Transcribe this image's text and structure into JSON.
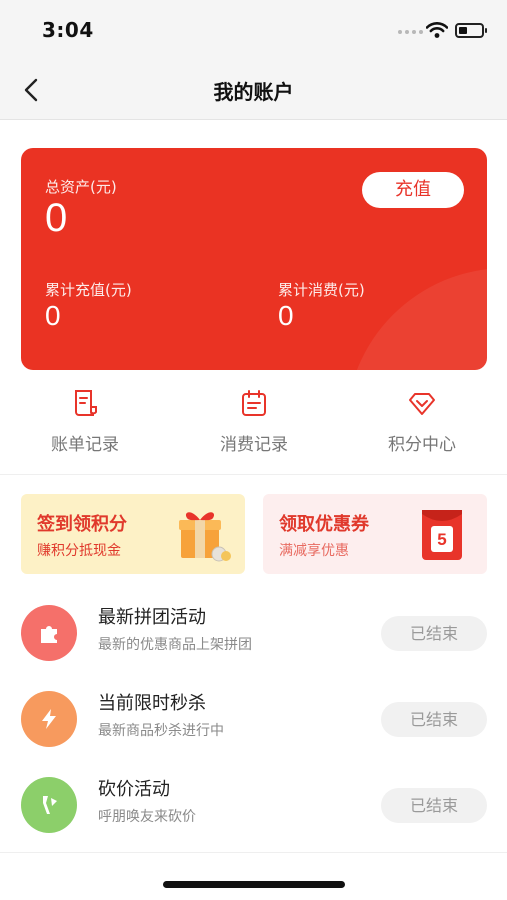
{
  "status_bar": {
    "time": "3:04"
  },
  "nav": {
    "title": "我的账户"
  },
  "account": {
    "total_label": "总资产(元)",
    "total_value": "0",
    "recharge_label": "充值",
    "recharged_label": "累计充值(元)",
    "recharged_value": "0",
    "spent_label": "累计消费(元)",
    "spent_value": "0"
  },
  "entries": [
    {
      "label": "账单记录",
      "icon": "bill-icon"
    },
    {
      "label": "消费记录",
      "icon": "calendar-icon"
    },
    {
      "label": "积分中心",
      "icon": "diamond-icon"
    }
  ],
  "promos": [
    {
      "title": "签到领积分",
      "subtitle": "赚积分抵现金",
      "icon": "gift-icon"
    },
    {
      "title": "领取优惠券",
      "subtitle": "满减享优惠",
      "icon": "red-envelope-icon",
      "badge": "5"
    }
  ],
  "activities": [
    {
      "title": "最新拼团活动",
      "desc": "最新的优惠商品上架拼团",
      "status": "已结束",
      "icon": "puzzle-icon",
      "color": "#f5706a"
    },
    {
      "title": "当前限时秒杀",
      "desc": "最新商品秒杀进行中",
      "status": "已结束",
      "icon": "lightning-icon",
      "color": "#f79a5e"
    },
    {
      "title": "砍价活动",
      "desc": "呼朋唤友来砍价",
      "status": "已结束",
      "icon": "axe-icon",
      "color": "#8ccf6a"
    }
  ],
  "colors": {
    "primary": "#ea3323",
    "nav_bg": "#f5f5f5",
    "signin_bg": "#fdf1c6",
    "coupon_bg": "#fdeeee"
  }
}
